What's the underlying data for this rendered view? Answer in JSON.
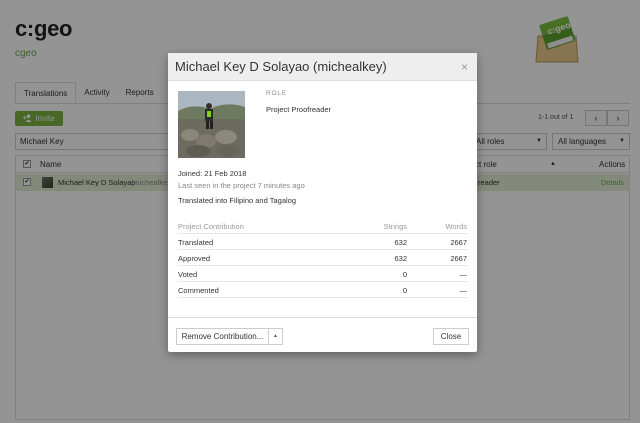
{
  "project": {
    "title": "c:geo",
    "subtitle": "cgeo",
    "logo_text": "c:geo"
  },
  "tabs": [
    {
      "label": "Translations"
    },
    {
      "label": "Activity"
    },
    {
      "label": "Reports"
    },
    {
      "label": "D"
    }
  ],
  "toolbar": {
    "invite_label": "Invite",
    "pager_text": "1-1 out of 1",
    "prev_icon": "chevron-left-icon",
    "next_icon": "chevron-right-icon"
  },
  "filters": {
    "search_value": "Michael Key",
    "roles_value": "All roles",
    "languages_value": "All languages"
  },
  "table": {
    "col_name": "Name",
    "col_role": "ct role",
    "sort_icon": "▲",
    "col_actions": "Actions",
    "rows": [
      {
        "name": "Michael Key D Solayao",
        "username": "(michealke",
        "role": "reader",
        "action": "Details"
      }
    ]
  },
  "modal": {
    "title": "Michael Key D Solayao (michealkey)",
    "close_glyph": "×",
    "role_label": "ROLE",
    "role_value": "Project Proofreader",
    "joined": "Joined: 21 Feb 2018",
    "last_seen": "Last seen in the project 7 minutes ago",
    "translated_into": "Translated into Filipino and Tagalog",
    "contribution": {
      "headers": [
        "Project Contribution",
        "Strings",
        "Words"
      ],
      "rows": [
        {
          "label": "Translated",
          "strings": "632",
          "words": "2667"
        },
        {
          "label": "Approved",
          "strings": "632",
          "words": "2667"
        },
        {
          "label": "Voted",
          "strings": "0",
          "words": "—"
        },
        {
          "label": "Commented",
          "strings": "0",
          "words": "—"
        }
      ]
    },
    "remove_label": "Remove Contribution...",
    "remove_caret": "▲",
    "close_label": "Close"
  },
  "colors": {
    "accent": "#7cb342",
    "selected_row": "#e3eed4",
    "project_subtitle": "#6aa84f"
  }
}
